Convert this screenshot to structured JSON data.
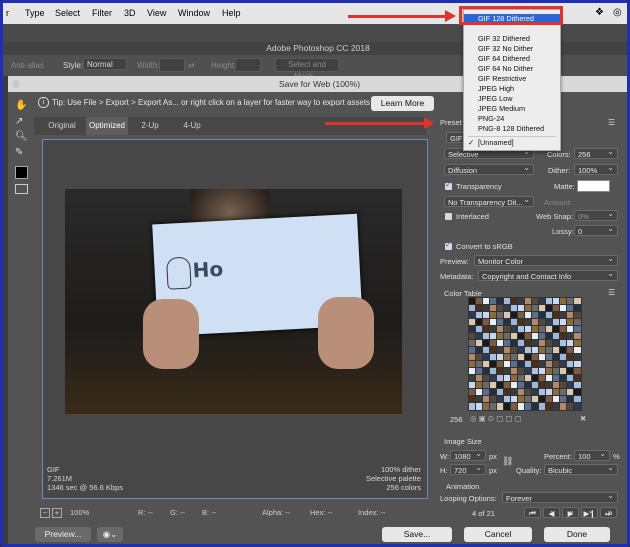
{
  "menu": [
    "r",
    "Type",
    "Select",
    "Filter",
    "3D",
    "View",
    "Window",
    "Help"
  ],
  "app_title": "Adobe Photoshop CC 2018",
  "options_bar": {
    "anti_alias": "Anti-alias",
    "style_label": "Style:",
    "style_value": "Normal",
    "width_label": "Width:",
    "height_label": "Height:",
    "select_mask": "Select and Mask..."
  },
  "dialog": {
    "title": "Save for Web (100%)",
    "tip": "Tip: Use File > Export > Export As... or right click on a layer for faster way to export assets",
    "learn_more": "Learn More",
    "tabs": [
      "Original",
      "Optimized",
      "2-Up",
      "4-Up"
    ],
    "info_left": [
      "GIF",
      "7.261M",
      "1346 sec @ 56.6 Kbps"
    ],
    "info_right": [
      "100% dither",
      "Selective palette",
      "256 colors"
    ],
    "zoom": "100%",
    "readouts": [
      "R: --",
      "G: --",
      "B: --",
      "Alpha: --",
      "Hex: --",
      "Index: --"
    ],
    "preview_btn": "Preview...",
    "save_btn": "Save...",
    "cancel_btn": "Cancel",
    "done_btn": "Done",
    "image_text": "Ho"
  },
  "right_panel": {
    "preset_label": "Preset",
    "format": "GIF",
    "reduction": "Selective",
    "colors_label": "Colors:",
    "colors_value": "256",
    "dither_algo": "Diffusion",
    "dither_label": "Dither:",
    "dither_value": "100%",
    "transparency": "Transparency",
    "matte_label": "Matte:",
    "transparency_dither": "No Transparency Dit...",
    "amount_label": "Amount:",
    "interlaced": "Interlaced",
    "websnap_label": "Web Snap:",
    "websnap_value": "0%",
    "lossy_label": "Lossy:",
    "lossy_value": "0",
    "convert_srgb": "Convert to sRGB",
    "preview_label": "Preview:",
    "preview_value": "Monitor Color",
    "metadata_label": "Metadata:",
    "metadata_value": "Copyright and Contact Info",
    "color_table_label": "Color Table",
    "color_count": "256",
    "image_size_label": "Image Size",
    "w_label": "W:",
    "w_value": "1080",
    "h_label": "H:",
    "h_value": "720",
    "px": "px",
    "percent_label": "Percent:",
    "percent_value": "100",
    "percent_unit": "%",
    "quality_label": "Quality:",
    "quality_value": "Bicubic",
    "animation_label": "Animation",
    "looping_label": "Looping Options:",
    "looping_value": "Forever",
    "frame_counter": "4 of 21"
  },
  "preset_menu": {
    "items": [
      "GIF 128 Dithered",
      "GIF 32 Dithered",
      "GIF 32 No Dither",
      "GIF 64 Dithered",
      "GIF 64 No Dither",
      "GIF Restrictive",
      "JPEG High",
      "JPEG Low",
      "JPEG Medium",
      "PNG-24",
      "PNG-8 128 Dithered",
      "[Unnamed]"
    ],
    "highlighted": "GIF 128 Dithered",
    "checked": "[Unnamed]"
  },
  "colors": {
    "annotation_red": "#e0332d",
    "highlight_blue": "#2f64d6",
    "frame_border": "#1f2fb0"
  }
}
